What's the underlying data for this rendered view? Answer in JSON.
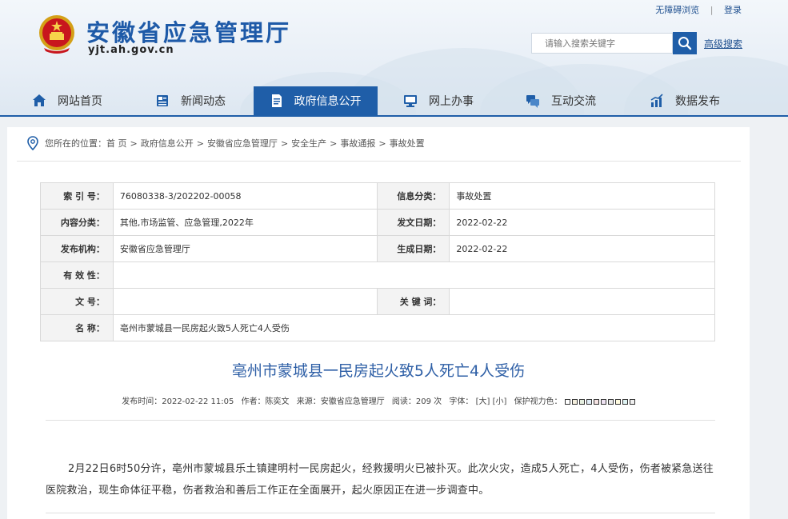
{
  "header": {
    "title": "安徽省应急管理厅",
    "domain": "yjt.ah.gov.cn",
    "top_links": {
      "accessible": "无障碍浏览",
      "login": "登录"
    },
    "search_placeholder": "请输入搜索关键字",
    "advanced_search": "高级搜索"
  },
  "nav": [
    {
      "label": "网站首页",
      "icon": "home-icon"
    },
    {
      "label": "新闻动态",
      "icon": "news-icon"
    },
    {
      "label": "政府信息公开",
      "icon": "document-icon"
    },
    {
      "label": "网上办事",
      "icon": "monitor-icon"
    },
    {
      "label": "互动交流",
      "icon": "chat-icon"
    },
    {
      "label": "数据发布",
      "icon": "chart-icon"
    }
  ],
  "breadcrumb": {
    "prefix": "您所在的位置：",
    "items": [
      "首 页",
      "政府信息公开",
      "安徽省应急管理厅",
      "安全生产",
      "事故通报",
      "事故处置"
    ]
  },
  "meta": {
    "index_label": "索 引 号：",
    "index_value": "76080338-3/202202-00058",
    "category_label": "信息分类：",
    "category_value": "事故处置",
    "content_label": "内容分类：",
    "content_value": "其他,市场监管、应急管理,2022年",
    "date_label": "发文日期：",
    "date_value": "2022-02-22",
    "org_label": "发布机构：",
    "org_value": "安徽省应急管理厅",
    "gen_label": "生成日期：",
    "gen_value": "2022-02-22",
    "validity_label": "有 效 性：",
    "validity_value": "",
    "docno_label": "文 号：",
    "docno_value": "",
    "keywords_label": "关 键 词：",
    "keywords_value": "",
    "name_label": "名 称：",
    "name_value": "亳州市蒙城县一民房起火致5人死亡4人受伤"
  },
  "article": {
    "title": "亳州市蒙城县一民房起火致5人死亡4人受伤",
    "publish_time": "发布时间：2022-02-22 11:05",
    "author": "作者：陈奕文",
    "source": "来源：安徽省应急管理厅",
    "reads": "阅读：209 次",
    "font_label": "字体：",
    "font_large": "[大]",
    "font_small": "[小]",
    "eye_label": "保护视力色：",
    "body": "2月22日6时50分许，亳州市蒙城县乐土镇建明村一民房起火，经救援明火已被扑灭。此次火灾，造成5人死亡，4人受伤，伤者被紧急送往医院救治，现生命体征平稳，伤者救治和善后工作正在全面展开，起火原因正在进一步调查中。"
  },
  "eye_colors": [
    "#ffffff",
    "#f4efde",
    "#e6efe0",
    "#e2eef8",
    "#f6e4e4",
    "#efe3f3",
    "#e8e8e8",
    "#fffbe0",
    "#e0f4f4",
    "#f0f0f0"
  ],
  "colors": {
    "brand": "#1f5ea8",
    "title": "#2e5fa6"
  }
}
